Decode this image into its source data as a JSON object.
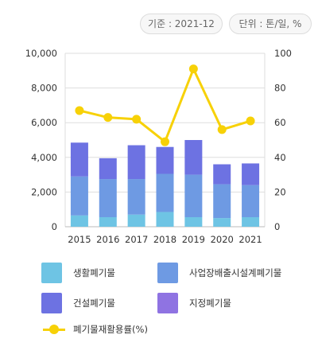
{
  "header": {
    "base_label": "기준 : 2021-12",
    "unit_label": "단위 : 톤/일, %"
  },
  "colors": {
    "living": "#6ec4e4",
    "business": "#6e9ae3",
    "construction": "#6d72e2",
    "designated": "#8f73e2",
    "recycling": "#f7d107",
    "grid": "#dddddd"
  },
  "chart_data": {
    "type": "bar",
    "stacked": true,
    "categories": [
      "2015",
      "2016",
      "2017",
      "2018",
      "2019",
      "2020",
      "2021"
    ],
    "y_left": {
      "ylim": [
        0,
        10000
      ],
      "ticks": [
        "0",
        "2,000",
        "4,000",
        "6,000",
        "8,000",
        "10,000"
      ],
      "tick_values": [
        0,
        2000,
        4000,
        6000,
        8000,
        10000
      ]
    },
    "y_right": {
      "ylim": [
        0,
        100
      ],
      "ticks": [
        "0",
        "20",
        "40",
        "60",
        "80",
        "100"
      ],
      "tick_values": [
        0,
        20,
        40,
        60,
        80,
        100
      ]
    },
    "series": [
      {
        "name": "생활폐기물",
        "key": "living",
        "type": "bar",
        "values": [
          650,
          550,
          700,
          850,
          550,
          500,
          550
        ]
      },
      {
        "name": "사업장배출시설계폐기물",
        "key": "business",
        "type": "bar",
        "values": [
          2250,
          2200,
          2050,
          2200,
          2450,
          1950,
          1850
        ]
      },
      {
        "name": "건설폐기물",
        "key": "construction",
        "type": "bar",
        "values": [
          1950,
          1200,
          1950,
          1550,
          2000,
          1150,
          1250
        ]
      },
      {
        "name": "지정폐기물",
        "key": "designated",
        "type": "bar",
        "values": [
          0,
          0,
          0,
          0,
          0,
          0,
          0
        ]
      },
      {
        "name": "폐기물재활용률(%)",
        "key": "recycling",
        "type": "line",
        "axis": "right",
        "values": [
          67,
          63,
          62,
          49,
          91,
          56,
          61
        ]
      }
    ],
    "grid": true,
    "legend_position": "bottom"
  }
}
